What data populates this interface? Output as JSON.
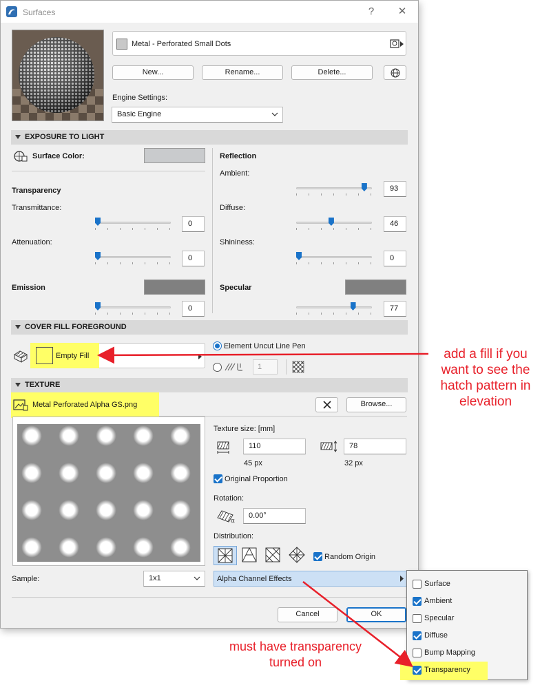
{
  "window": {
    "title": "Surfaces",
    "help_glyph": "?",
    "close_glyph": "✕"
  },
  "header": {
    "surface_name": "Metal - Perforated Small Dots",
    "buttons": {
      "new": "New...",
      "rename": "Rename...",
      "delete": "Delete..."
    },
    "engine_label": "Engine Settings:",
    "engine_value": "Basic Engine"
  },
  "exposure": {
    "title": "EXPOSURE TO LIGHT",
    "surface_color_label": "Surface Color:",
    "transparency_heading": "Transparency",
    "transmittance_label": "Transmittance:",
    "transmittance_value": "0",
    "attenuation_label": "Attenuation:",
    "attenuation_value": "0",
    "emission_label": "Emission",
    "emission_value": "0",
    "reflection_heading": "Reflection",
    "ambient_label": "Ambient:",
    "ambient_value": "93",
    "diffuse_label": "Diffuse:",
    "diffuse_value": "46",
    "shininess_label": "Shininess:",
    "shininess_value": "0",
    "specular_label": "Specular",
    "specular_value": "77",
    "colors": {
      "surface": "#c9cbcd",
      "emission": "#808080",
      "specular": "#808080"
    }
  },
  "cover_fill": {
    "title": "COVER FILL FOREGROUND",
    "fill_name": "Empty Fill",
    "pen_option_label": "Element Uncut Line Pen",
    "pen_number": "1"
  },
  "texture": {
    "title": "TEXTURE",
    "file_name": "Metal Perforated Alpha GS.png",
    "browse_label": "Browse...",
    "size_label": "Texture size: [mm]",
    "width_value": "110",
    "height_value": "78",
    "width_px": "45 px",
    "height_px": "32 px",
    "original_proportion_label": "Original Proportion",
    "rotation_label": "Rotation:",
    "rotation_value": "0.00°",
    "distribution_label": "Distribution:",
    "random_origin_label": "Random Origin",
    "sample_label": "Sample:",
    "sample_value": "1x1",
    "alpha_effects_label": "Alpha Channel Effects"
  },
  "footer": {
    "cancel": "Cancel",
    "ok": "OK"
  },
  "alpha_menu": {
    "items": [
      {
        "label": "Surface",
        "checked": false
      },
      {
        "label": "Ambient",
        "checked": true
      },
      {
        "label": "Specular",
        "checked": false
      },
      {
        "label": "Diffuse",
        "checked": true
      },
      {
        "label": "Bump Mapping",
        "checked": false
      },
      {
        "label": "Transparency",
        "checked": true
      }
    ]
  },
  "annotations": {
    "fill_note": "add a fill if you want to see the hatch pattern in elevation",
    "fill_note_lines": [
      "add a fill if you",
      "want to see the",
      "hatch pattern in",
      "elevation"
    ],
    "transparency_note_lines": [
      "must have transparency",
      "turned on"
    ],
    "arrow_color": "#e8202a",
    "highlight_color": "#ffff66"
  },
  "sliders": {
    "transmittance": 0.0,
    "attenuation": 0.0,
    "emission": 0.0,
    "ambient": 0.93,
    "diffuse": 0.46,
    "shininess": 0.0,
    "specular": 0.77
  }
}
